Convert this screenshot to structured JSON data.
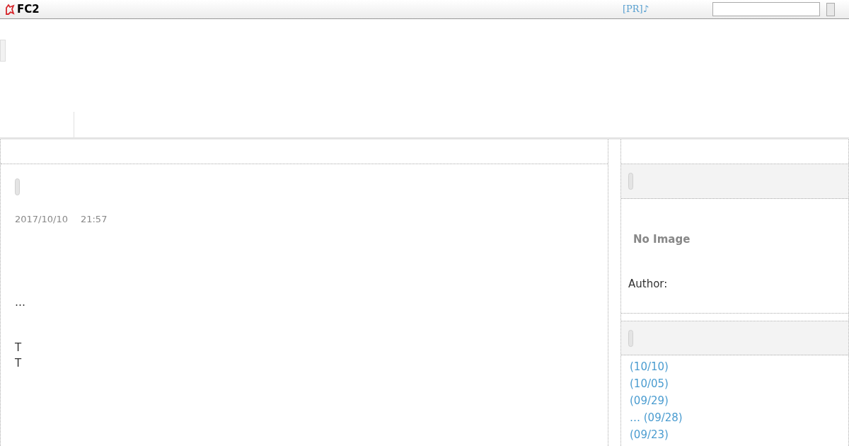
{
  "topbar": {
    "logo": "FC2",
    "pr_link": "[PR]♪"
  },
  "entry": {
    "date": "2017/10/10",
    "time": "21:57",
    "excerpt": "…",
    "lines": [
      "T",
      "T"
    ]
  },
  "profile": {
    "no_image": "No Image",
    "author_label": "Author:"
  },
  "recent_entries": [
    {
      "text": "(10/10)"
    },
    {
      "text": "(10/05)"
    },
    {
      "text": "(09/29)"
    },
    {
      "text": "… (09/28)"
    },
    {
      "text": "(09/23)"
    }
  ]
}
